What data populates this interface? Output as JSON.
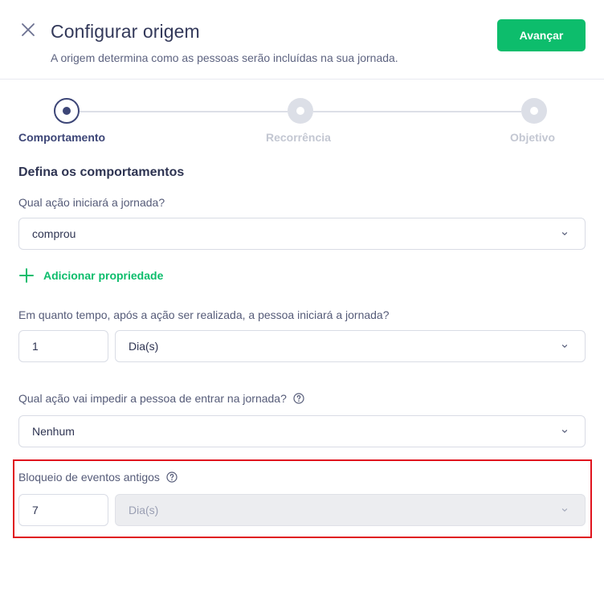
{
  "header": {
    "title": "Configurar origem",
    "subtitle": "A origem determina como as pessoas serão incluídas na sua jornada.",
    "advance_label": "Avançar"
  },
  "stepper": {
    "steps": [
      {
        "label": "Comportamento",
        "state": "active"
      },
      {
        "label": "Recorrência",
        "state": "inactive"
      },
      {
        "label": "Objetivo",
        "state": "inactive"
      }
    ]
  },
  "form": {
    "section_title": "Defina os comportamentos",
    "start_action": {
      "label": "Qual ação iniciará a jornada?",
      "value": "comprou"
    },
    "add_property_label": "Adicionar propriedade",
    "delay": {
      "label": "Em quanto tempo, após a ação ser realizada, a pessoa iniciará a jornada?",
      "amount": "1",
      "unit": "Dia(s)"
    },
    "block_action": {
      "label": "Qual ação vai impedir a pessoa de entrar na jornada?",
      "value": "Nenhum"
    },
    "old_events": {
      "label": "Bloqueio de eventos antigos",
      "amount": "7",
      "unit": "Dia(s)"
    }
  },
  "colors": {
    "accent_green": "#0dbd6c",
    "primary_navy": "#3d4677",
    "highlight_red": "#e0141e"
  },
  "icons": [
    "close-icon",
    "plus-icon",
    "chevron-down-icon",
    "help-circle-icon"
  ]
}
